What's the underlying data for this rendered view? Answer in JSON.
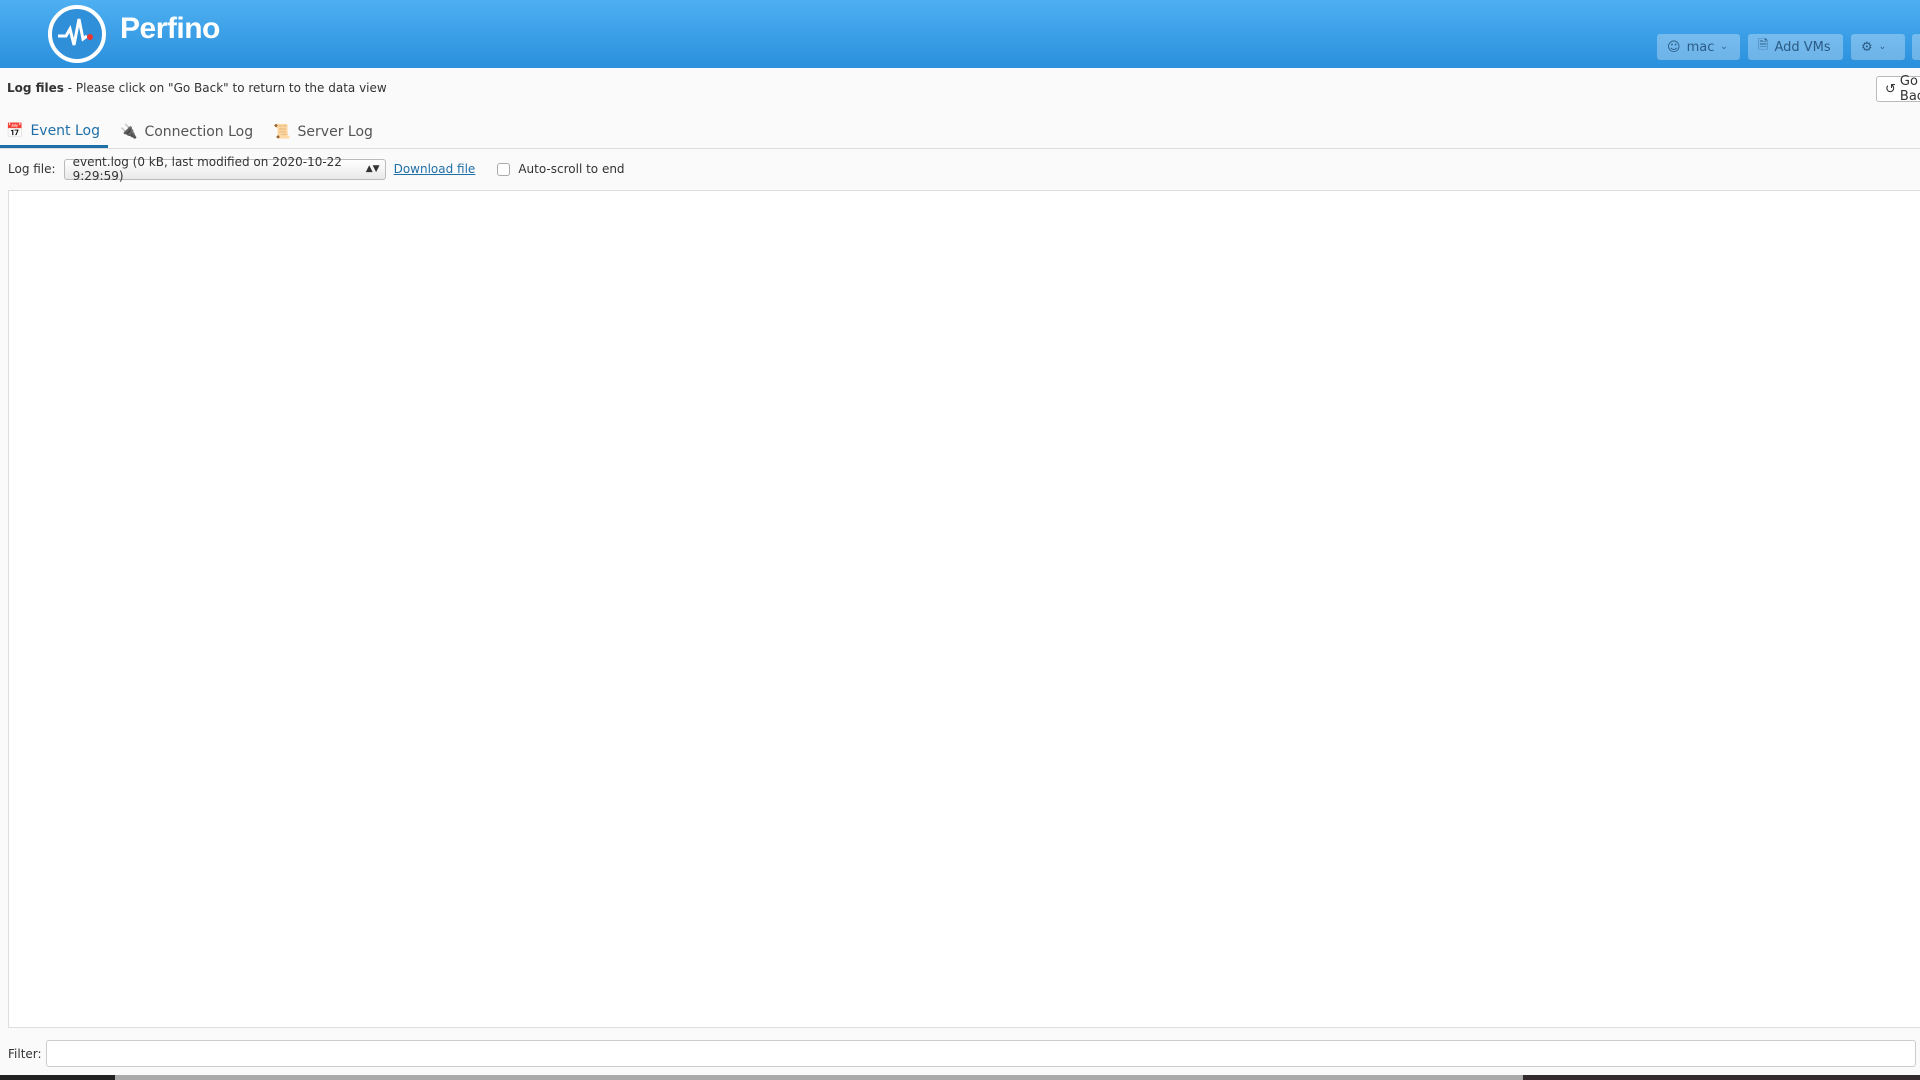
{
  "header": {
    "brand": "Perfino",
    "user_label": "mac",
    "add_vms_label": "Add VMs",
    "go_back_label": "Go Back"
  },
  "page": {
    "title_bold": "Log files",
    "title_rest": " - Please click on \"Go Back\" to return to the data view"
  },
  "tabs": [
    {
      "label": "Event Log",
      "icon": "calendar-icon",
      "active": true
    },
    {
      "label": "Connection Log",
      "icon": "plug-icon"
    },
    {
      "label": "Server Log",
      "icon": "scroll-icon"
    }
  ],
  "toolbar": {
    "log_file_label": "Log file:",
    "log_file_value": "event.log (0 kB, last modified on 2020-10-22 9:29:59)",
    "download_label": "Download file",
    "autoscroll_label": "Auto-scroll to end",
    "autoscroll_checked": false
  },
  "filter": {
    "label": "Filter:",
    "value": ""
  },
  "colors": {
    "header": "#2a8fdc",
    "accent": "#1f6fa8"
  }
}
